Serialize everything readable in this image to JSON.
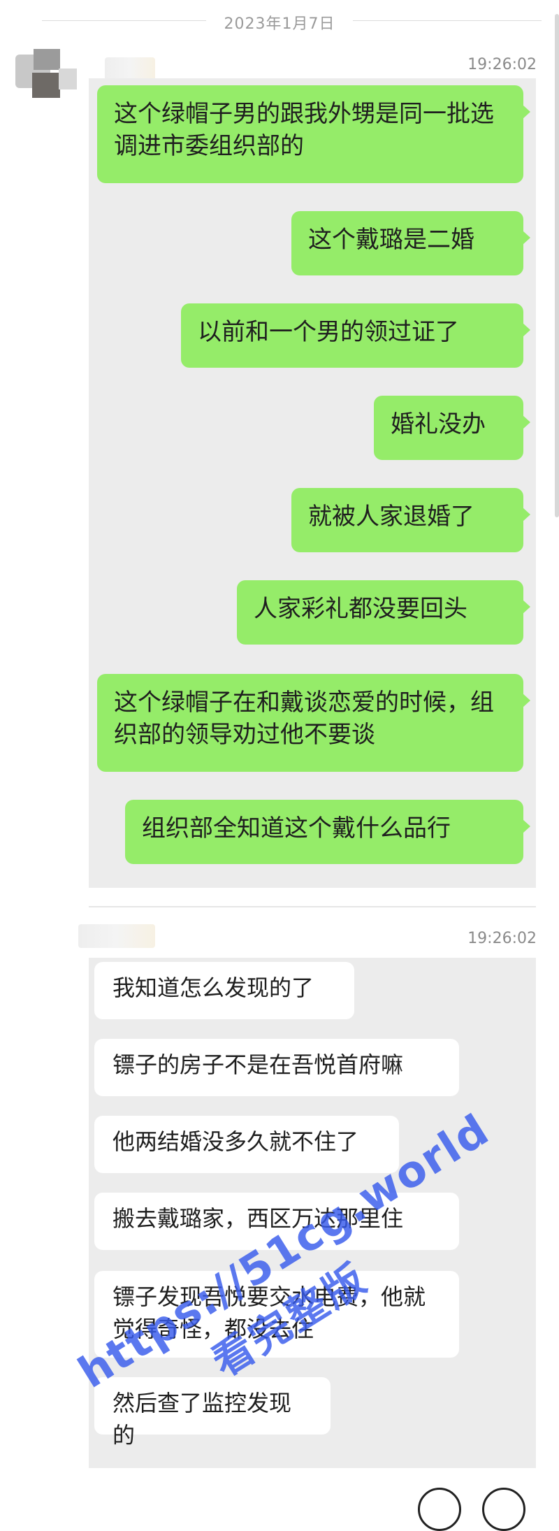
{
  "header": {
    "date": "2023年1月7日"
  },
  "messages": [
    {
      "time": "19:26:02",
      "bubbles": [
        "这个绿帽子男的跟我外甥是同一批选调进市委组织部的",
        "这个戴璐是二婚",
        "以前和一个男的领过证了",
        "婚礼没办",
        "就被人家退婚了",
        "人家彩礼都没要回头",
        "这个绿帽子在和戴谈恋爱的时候，组织部的领导劝过他不要谈",
        "组织部全知道这个戴什么品行"
      ]
    },
    {
      "time": "19:26:02",
      "bubbles": [
        "我知道怎么发现的了",
        "镖子的房子不是在吾悦首府嘛",
        "他两结婚没多久就不住了",
        "搬去戴璐家，西区万达那里住",
        "镖子发现吾悦要交水电费，他就觉得奇怪，都没去住",
        "然后查了监控发现的"
      ]
    }
  ],
  "watermark": {
    "line1": "https://51cg.world",
    "line2": "看完整版"
  },
  "colors": {
    "green_bubble": "#95ec69",
    "white_bubble": "#ffffff",
    "shot_bg": "#ececec",
    "watermark": "#375aeb"
  }
}
